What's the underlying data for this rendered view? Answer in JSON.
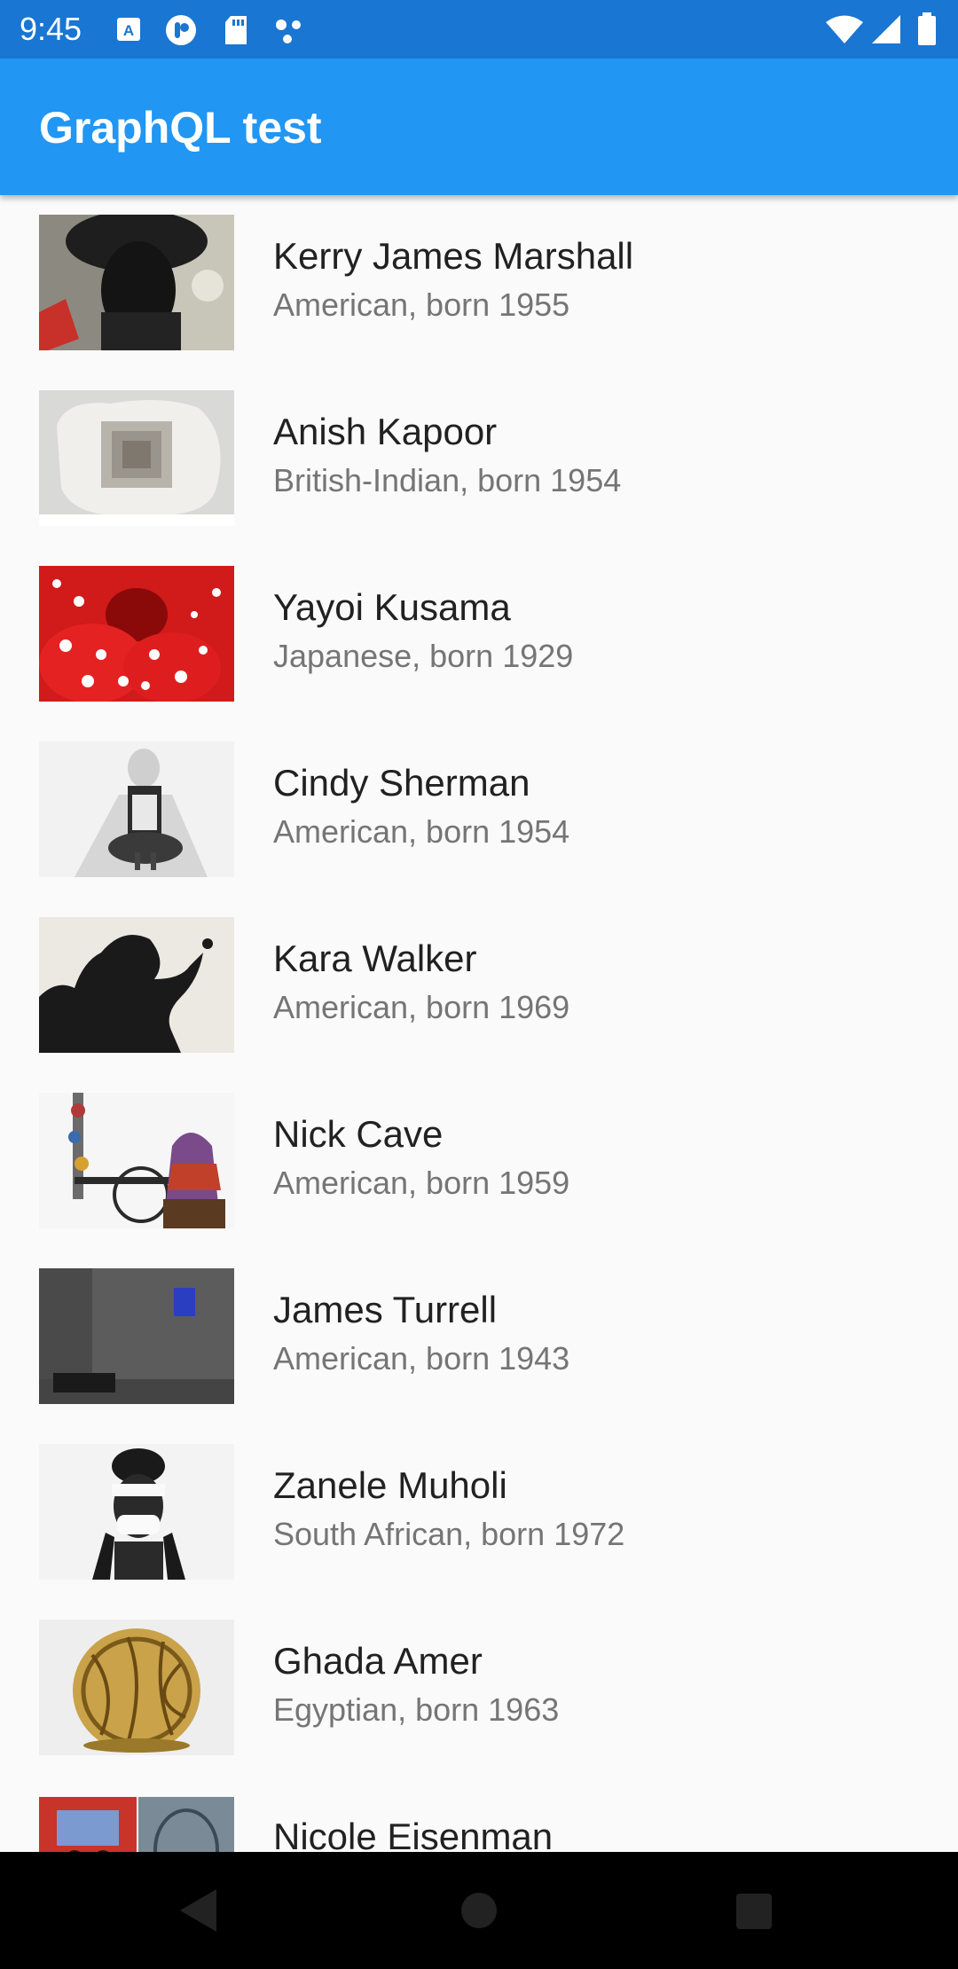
{
  "status_bar": {
    "time": "9:45",
    "left_icons": [
      "keyboard-a-icon",
      "pocket-icon",
      "sd-card-icon",
      "dots-icon"
    ],
    "right_icons": [
      "wifi-icon",
      "signal-icon",
      "battery-icon"
    ]
  },
  "app_bar": {
    "title": "GraphQL test",
    "color": "#2196f3"
  },
  "artists": [
    {
      "name": "Kerry James Marshall",
      "info": "American, born 1955"
    },
    {
      "name": "Anish Kapoor",
      "info": "British-Indian, born 1954"
    },
    {
      "name": "Yayoi Kusama",
      "info": "Japanese, born 1929"
    },
    {
      "name": "Cindy Sherman",
      "info": "American, born 1954"
    },
    {
      "name": "Kara Walker",
      "info": "American, born 1969"
    },
    {
      "name": "Nick Cave",
      "info": "American, born 1959"
    },
    {
      "name": "James Turrell",
      "info": "American, born 1943"
    },
    {
      "name": "Zanele Muholi",
      "info": "South African, born 1972"
    },
    {
      "name": "Ghada Amer",
      "info": "Egyptian, born 1963"
    },
    {
      "name": "Nicole Eisenman",
      "info": ""
    }
  ],
  "nav_bar": {
    "buttons": [
      "back-icon",
      "home-icon",
      "recents-icon"
    ]
  }
}
